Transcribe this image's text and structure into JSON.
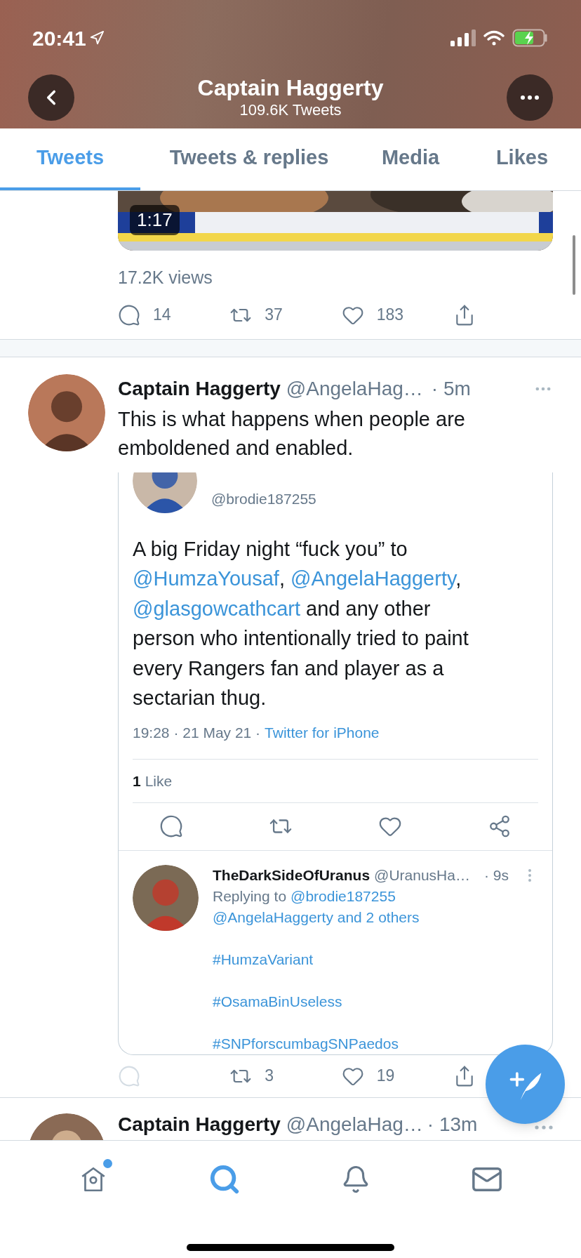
{
  "status_bar": {
    "time": "20:41"
  },
  "header": {
    "title": "Captain Haggerty",
    "subtitle": "109.6K Tweets"
  },
  "tabs": [
    {
      "label": "Tweets",
      "selected": true
    },
    {
      "label": "Tweets & replies",
      "selected": false
    },
    {
      "label": "Media",
      "selected": false
    },
    {
      "label": "Likes",
      "selected": false
    }
  ],
  "video_tweet": {
    "duration": "1:17",
    "views": "17.2K views",
    "actions": [
      {
        "kind": "reply",
        "count": "14",
        "disabled": false
      },
      {
        "kind": "retweet",
        "count": "37",
        "disabled": false
      },
      {
        "kind": "like",
        "count": "183",
        "disabled": false
      },
      {
        "kind": "share",
        "disabled": false
      }
    ]
  },
  "tweet": {
    "name": "Captain Haggerty",
    "handle": "@AngelaHag…",
    "time": "· 5m",
    "text": "This is what happens when people are emboldened and enabled.",
    "quoted": {
      "handle": "@brodie187255",
      "text": [
        {
          "kind": "text",
          "value": "A big Friday night “fuck you” to "
        },
        {
          "kind": "mention",
          "value": "@HumzaYousaf"
        },
        {
          "kind": "text",
          "value": ", "
        },
        {
          "kind": "mention",
          "value": "@AngelaHaggerty"
        },
        {
          "kind": "text",
          "value": ", "
        },
        {
          "kind": "mention",
          "value": "@glasgowcathcart"
        },
        {
          "kind": "text",
          "value": " and any other person who intentionally tried to paint every Rangers fan and player as a sectarian thug."
        }
      ],
      "meta": "19:28 · 21 May 21 ·",
      "source": "Twitter for iPhone",
      "like_count": "1",
      "like_label": "Like",
      "actions": [
        {
          "kind": "reply"
        },
        {
          "kind": "retweet"
        },
        {
          "kind": "like"
        },
        {
          "kind": "share-network"
        }
      ],
      "reply": {
        "name": "TheDarkSideOfUranus",
        "handle": "@UranusHa…",
        "time": "· 9s",
        "replying_prefix": "Replying to",
        "replying_to": "@brodie187255",
        "replying_more": "@AngelaHaggerty and 2 others",
        "hashtags": [
          "#HumzaVariant",
          "#OsamaBinUseless",
          "#SNPforscumbagSNPaedos"
        ]
      }
    },
    "actions": [
      {
        "kind": "reply",
        "disabled": true
      },
      {
        "kind": "retweet",
        "count": "3",
        "disabled": false
      },
      {
        "kind": "like",
        "count": "19",
        "disabled": false
      },
      {
        "kind": "share",
        "disabled": false
      }
    ]
  },
  "next_tweet": {
    "name": "Captain Haggerty",
    "handle": "@AngelaHag…",
    "time": "· 13m"
  },
  "bottom_nav": [
    {
      "kind": "home",
      "selected": false,
      "has_dot": true
    },
    {
      "kind": "search",
      "selected": true,
      "has_dot": false
    },
    {
      "kind": "notifications",
      "selected": false,
      "has_dot": false
    },
    {
      "kind": "messages",
      "selected": false,
      "has_dot": false
    }
  ]
}
